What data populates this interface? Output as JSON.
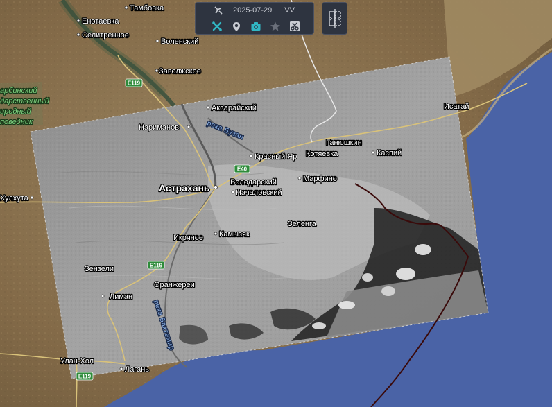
{
  "toolbar": {
    "date": "2025-07-29",
    "mode": "VV",
    "icons": [
      "satellite-icon",
      "tools-icon",
      "layers-icon",
      "camera-icon",
      "star-icon",
      "scissors-icon"
    ],
    "accent_color": "#31b7c4"
  },
  "split_button": {
    "icon": "split-view-icon"
  },
  "map": {
    "places": {
      "enotaevka": "Енотаевка",
      "tambovka": "Тамбовка",
      "selitrennoe": "Селитренное",
      "volenskiy": "Воленский",
      "zavolzhskoe": "Заволжское",
      "aksaraiskiy": "Аксарайский",
      "narimanov": "Нариманов",
      "krasny_yar": "Красный Яр",
      "ganyushkin": "Ганюшкин",
      "kotyaevka": "Котяевка",
      "kaspiy": "Каспий",
      "isatay": "Исатай",
      "astrakhan": "Астрахань",
      "volodarskiy": "Володарский",
      "nachalovskiy": "Началовский",
      "marfino": "Марфино",
      "khulkhuta": "Хулхута",
      "zelenga": "Зеленга",
      "ikryanoe": "Икряное",
      "kamyzyak": "Камызяк",
      "zenzeli": "Зензели",
      "oranzherei": "Оранжереи",
      "liman": "Лиман",
      "ulan_hol": "Улан-Хол",
      "lagan": "Лагань"
    },
    "rivers": {
      "buzan": "река Бузан",
      "bakhtemir": "река Бахтемир"
    },
    "reserve": [
      "арбинский",
      "дарственный",
      "иродный",
      "поведник"
    ],
    "roads": [
      "E119",
      "E40",
      "E119",
      "E119"
    ],
    "colors": {
      "sea": "#4a63a6",
      "land": "#8a7350",
      "overlay": "#9a9a9a",
      "border": "#3a0a0a"
    }
  }
}
